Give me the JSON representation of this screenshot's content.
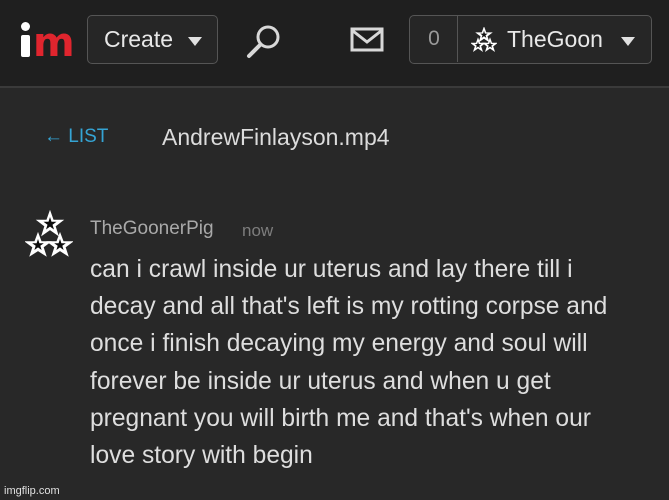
{
  "header": {
    "logo": {
      "icon": "imgflip-logo",
      "colors": {
        "i": "#ffffff",
        "m": "#e0252e"
      }
    },
    "create_label": "Create",
    "search_icon": "search-icon",
    "mail_icon": "mail-icon",
    "notification_count": "0",
    "username": "TheGoon"
  },
  "subnav": {
    "back_label": "← LIST",
    "title": "AndrewFinlayson.mp4"
  },
  "comment": {
    "username": "TheGoonerPig",
    "time": "now",
    "text": "can i crawl inside ur uterus and lay there till i\ndecay and all that's left is my rotting corpse and\nonce i finish decaying my energy and soul will\nforever be inside ur uterus and when u get\npregnant you will birth me and that's when our\nlove story with begin"
  },
  "watermark": "imgflip.com",
  "colors": {
    "background": "#282828",
    "topbar": "#1f1f1f",
    "link": "#35a4d4",
    "text": "#dedede",
    "muted": "#a9a9a9"
  }
}
